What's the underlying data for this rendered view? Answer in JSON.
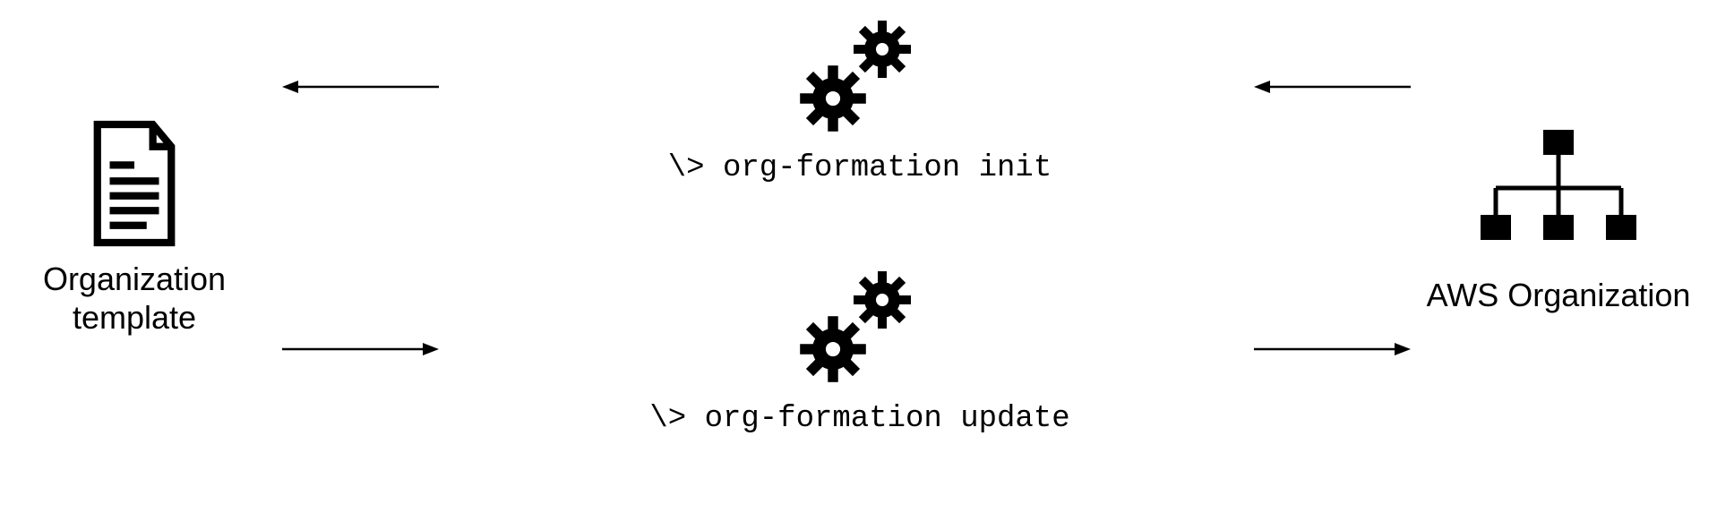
{
  "left": {
    "label_line1": "Organization",
    "label_line2": "template"
  },
  "right": {
    "label": "AWS Organization"
  },
  "commands": {
    "init": "\\> org-formation init",
    "update": "\\> org-formation update"
  },
  "icons": {
    "document": "document-icon",
    "gears_top": "gears-icon",
    "gears_bottom": "gears-icon",
    "org_tree": "org-chart-icon"
  }
}
